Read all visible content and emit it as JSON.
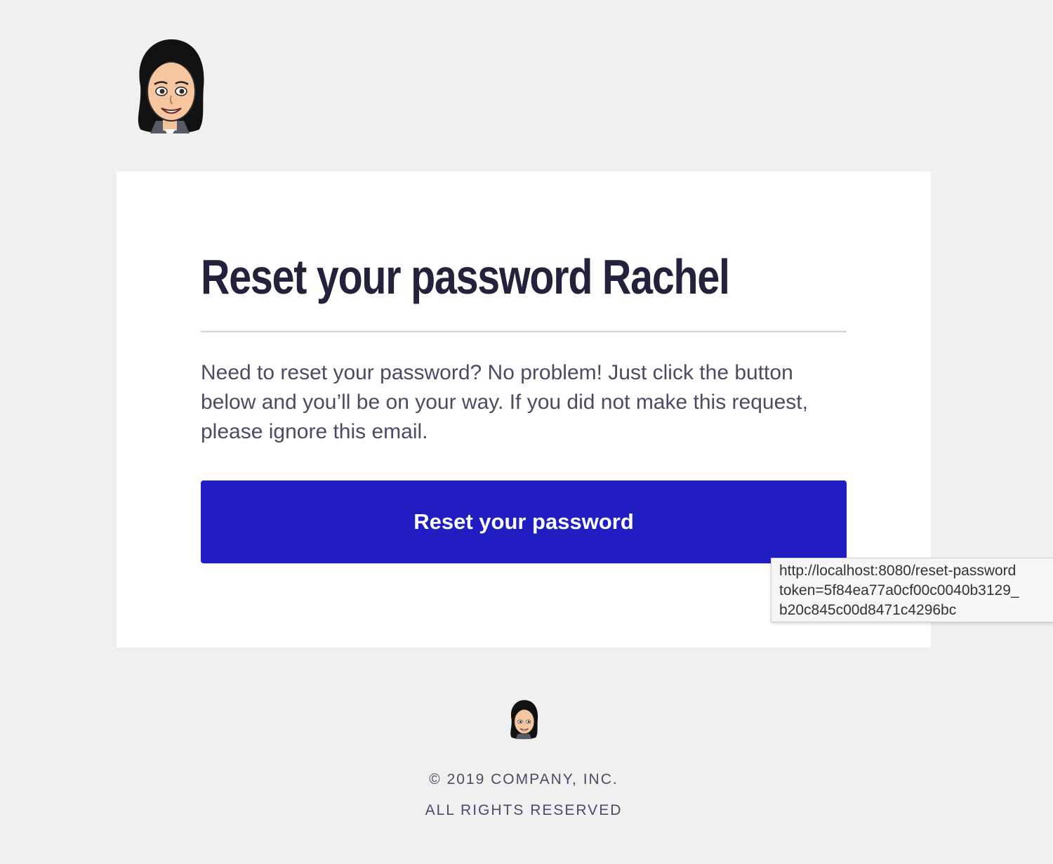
{
  "header": {
    "logo_icon": "avatar-bitmoji-icon"
  },
  "email": {
    "title": "Reset your password Rachel",
    "body": "Need to reset your password? No problem! Just click the button below and you’ll be on your way. If you did not make this request, please ignore this email.",
    "button_label": "Reset your password",
    "button_color": "#201ec3"
  },
  "tooltip": {
    "line1": "http://localhost:8080/reset-password",
    "line2": "token=5f84ea77a0cf00c0040b3129_",
    "line3": "b20c845c00d8471c4296bc"
  },
  "footer": {
    "logo_icon": "avatar-bitmoji-icon",
    "copyright": "© 2019 COMPANY, INC.",
    "rights": "ALL RIGHTS RESERVED"
  },
  "colors": {
    "page_background": "#f0f0f0",
    "card_background": "#ffffff",
    "title_color": "#22223d",
    "text_color": "#4b4b63"
  }
}
